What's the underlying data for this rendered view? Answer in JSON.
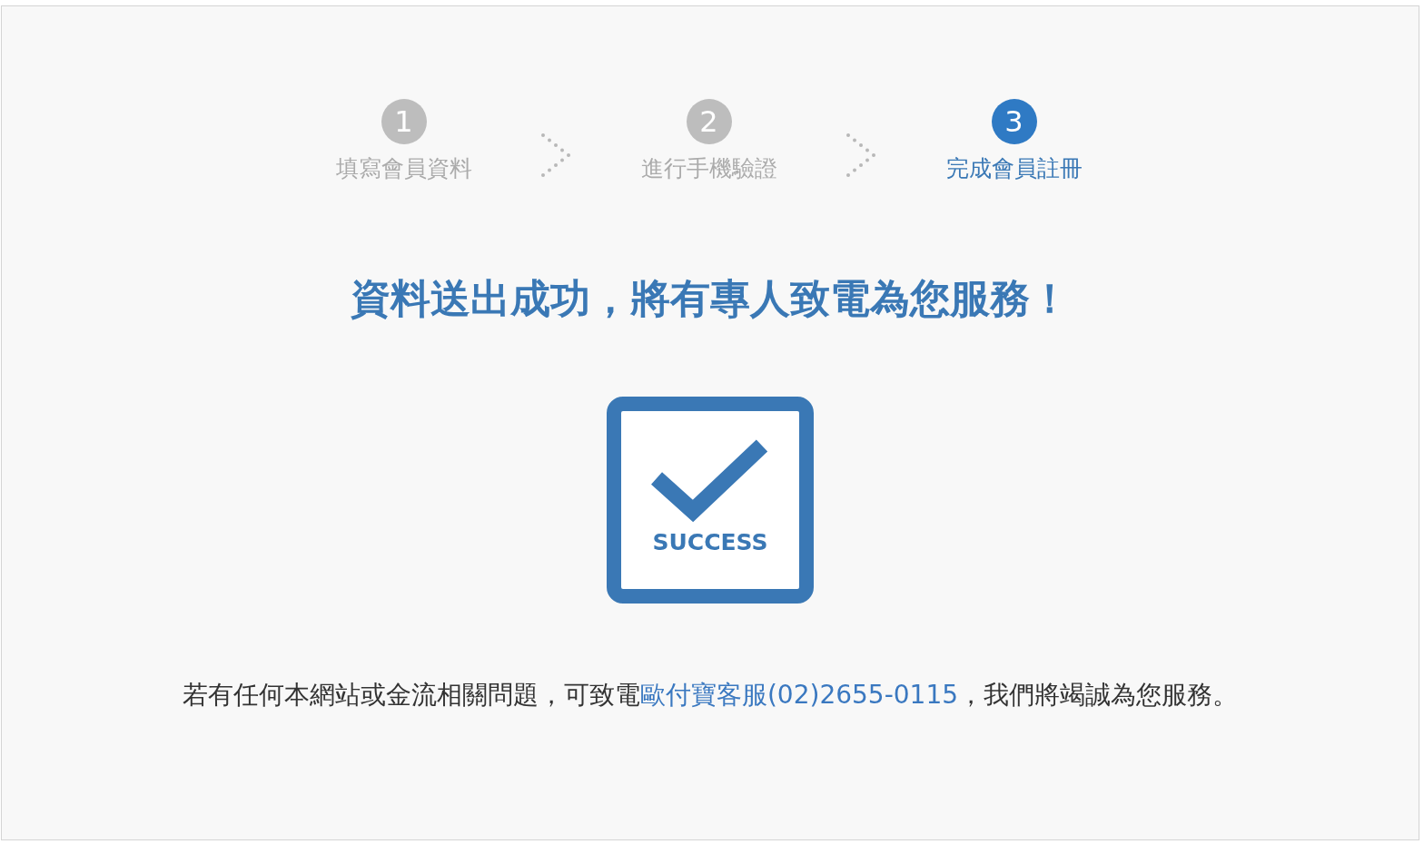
{
  "steps": [
    {
      "number": "1",
      "label": "填寫會員資料",
      "selected": false
    },
    {
      "number": "2",
      "label": "進行手機驗證",
      "selected": false
    },
    {
      "number": "3",
      "label": "完成會員註冊",
      "selected": true
    }
  ],
  "title": "資料送出成功，將有專人致電為您服務！",
  "success_label": "SUCCESS",
  "footer": {
    "before": "若有任何本網站或金流相關問題，可致電",
    "link": "歐付寶客服(02)2655-0115",
    "after": "，我們將竭誠為您服務。"
  }
}
